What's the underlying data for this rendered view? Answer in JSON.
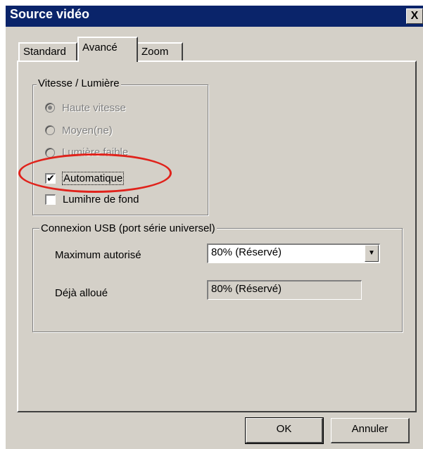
{
  "window": {
    "title": "Source vidéo",
    "close_label": "X"
  },
  "tabs": [
    {
      "label": "Standard"
    },
    {
      "label": "Avancé"
    },
    {
      "label": "Zoom"
    }
  ],
  "speed_group": {
    "legend": "Vitesse / Lumière",
    "radios": [
      {
        "label": "Haute vitesse",
        "checked": true,
        "enabled": false
      },
      {
        "label": "Moyen(ne)",
        "checked": false,
        "enabled": false
      },
      {
        "label": "Lumière faible",
        "checked": false,
        "enabled": false
      }
    ],
    "checkboxes": [
      {
        "label": "Automatique",
        "checked": true
      },
      {
        "label": "Lumihre de fond",
        "checked": false
      }
    ]
  },
  "usb_group": {
    "legend": "Connexion USB (port série universel)",
    "max_label": "Maximum autorisé",
    "max_value": "80% (Réservé)",
    "alloc_label": "Déjà alloué",
    "alloc_value": "80% (Réservé)"
  },
  "buttons": {
    "ok": "OK",
    "cancel": "Annuler"
  },
  "annotation": {
    "color": "#e0221b",
    "target": "Automatique"
  }
}
